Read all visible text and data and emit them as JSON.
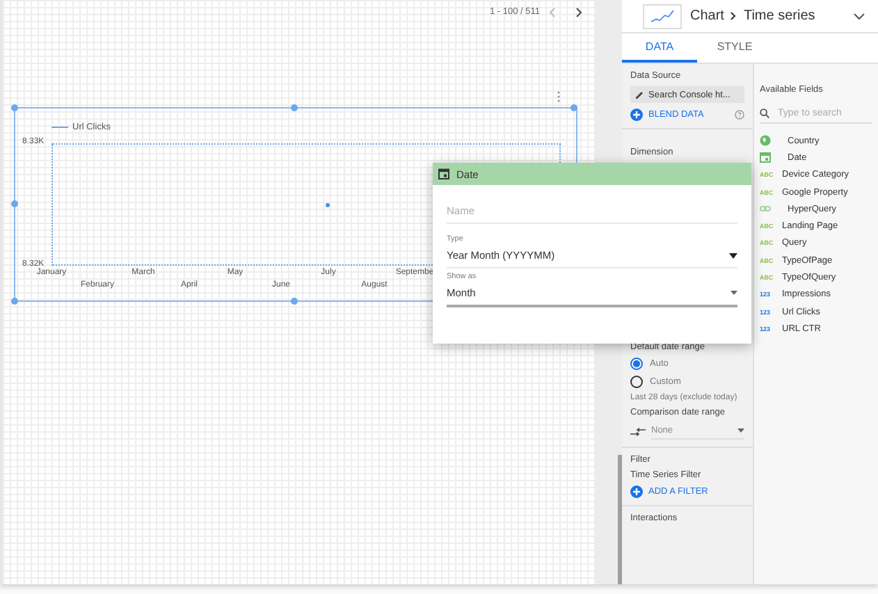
{
  "canvas": {
    "pagination": "1 - 100 / 511"
  },
  "chart": {
    "legend": "Url Clicks",
    "y_labels": [
      "8.33K",
      "8.32K"
    ],
    "x_labels": [
      "January",
      "February",
      "March",
      "April",
      "May",
      "June",
      "July",
      "August",
      "Septembe"
    ]
  },
  "panel": {
    "chart_type": "Chart",
    "chart_subtype": "Time series",
    "tabs": [
      {
        "label": "DATA",
        "selected": true
      },
      {
        "label": "STYLE",
        "selected": false
      }
    ],
    "data_source": {
      "heading": "Data Source",
      "source": "Search Console ht...",
      "blend": "BLEND DATA"
    },
    "dimension": {
      "heading": "Dimension"
    },
    "date_range": {
      "heading": "Default date range",
      "options": [
        {
          "label": "Auto",
          "selected": true
        },
        {
          "label": "Custom",
          "selected": false
        }
      ],
      "note": "Last 28 days (exclude today)"
    },
    "comparison": {
      "heading": "Comparison date range",
      "value": "None"
    },
    "filter": {
      "heading": "Filter",
      "subheading": "Time Series Filter",
      "add": "ADD A FILTER"
    },
    "interactions": {
      "heading": "Interactions"
    },
    "fields": {
      "heading": "Available Fields",
      "placeholder": "Type to search",
      "items": [
        {
          "kind": "geo",
          "name": "Country"
        },
        {
          "kind": "date",
          "name": "Date"
        },
        {
          "kind": "text",
          "badge": "ABC",
          "name": "Device Category"
        },
        {
          "kind": "text",
          "badge": "ABC",
          "name": "Google Property"
        },
        {
          "kind": "link",
          "name": "HyperQuery"
        },
        {
          "kind": "text",
          "badge": "ABC",
          "name": "Landing Page"
        },
        {
          "kind": "text",
          "badge": "ABC",
          "name": "Query"
        },
        {
          "kind": "text",
          "badge": "ABC",
          "name": "TypeOfPage"
        },
        {
          "kind": "text",
          "badge": "ABC",
          "name": "TypeOfQuery"
        },
        {
          "kind": "number",
          "badge": "123",
          "name": "Impressions"
        },
        {
          "kind": "number",
          "badge": "123",
          "name": "Url Clicks"
        },
        {
          "kind": "number",
          "badge": "123",
          "name": "URL CTR"
        }
      ]
    }
  },
  "popup": {
    "title": "Date",
    "name_placeholder": "Name",
    "type_label": "Type",
    "type_value": "Year Month (YYYYMM)",
    "show_label": "Show as",
    "show_value": "Month"
  }
}
